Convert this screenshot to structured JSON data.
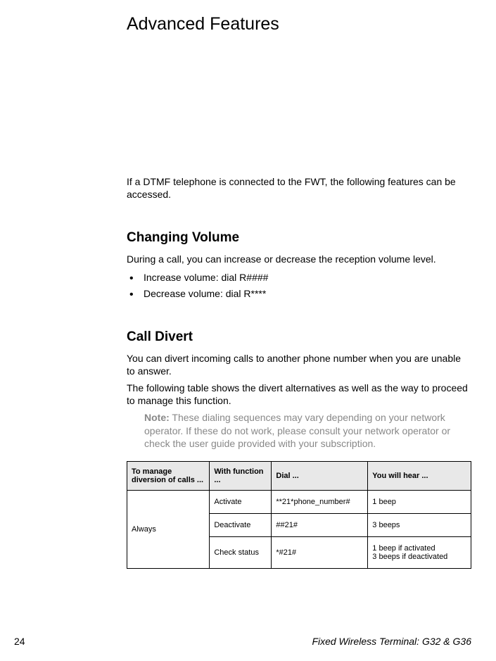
{
  "title": "Advanced Features",
  "intro": "If a DTMF telephone is connected to the FWT, the following features can be accessed.",
  "section1": {
    "title": "Changing Volume",
    "text": "During a call, you can increase or decrease the reception volume level.",
    "bullets": [
      "Increase volume: dial R####",
      "Decrease volume: dial R****"
    ]
  },
  "section2": {
    "title": "Call Divert",
    "text1": "You can divert incoming calls to another phone number when you are unable to answer.",
    "text2": "The following table shows the divert alternatives as well as the way to proceed to manage this function.",
    "note_label": "Note:",
    "note_text": " These dialing sequences may vary depending on your network operator. If these do not work, please consult your network operator or check the user guide provided with your subscription."
  },
  "table": {
    "headers": [
      "To manage diversion of calls ...",
      "With function ...",
      "Dial ...",
      "You will hear ..."
    ],
    "rowspan_label": "Always",
    "rows": [
      [
        "Activate",
        "**21*phone_number#",
        "1 beep"
      ],
      [
        "Deactivate",
        "##21#",
        "3 beeps"
      ],
      [
        "Check status",
        "*#21#",
        "1 beep if activated\n3 beeps if deactivated"
      ]
    ]
  },
  "footer": {
    "page": "24",
    "doc_title": "Fixed Wireless Terminal: G32 & G36"
  }
}
